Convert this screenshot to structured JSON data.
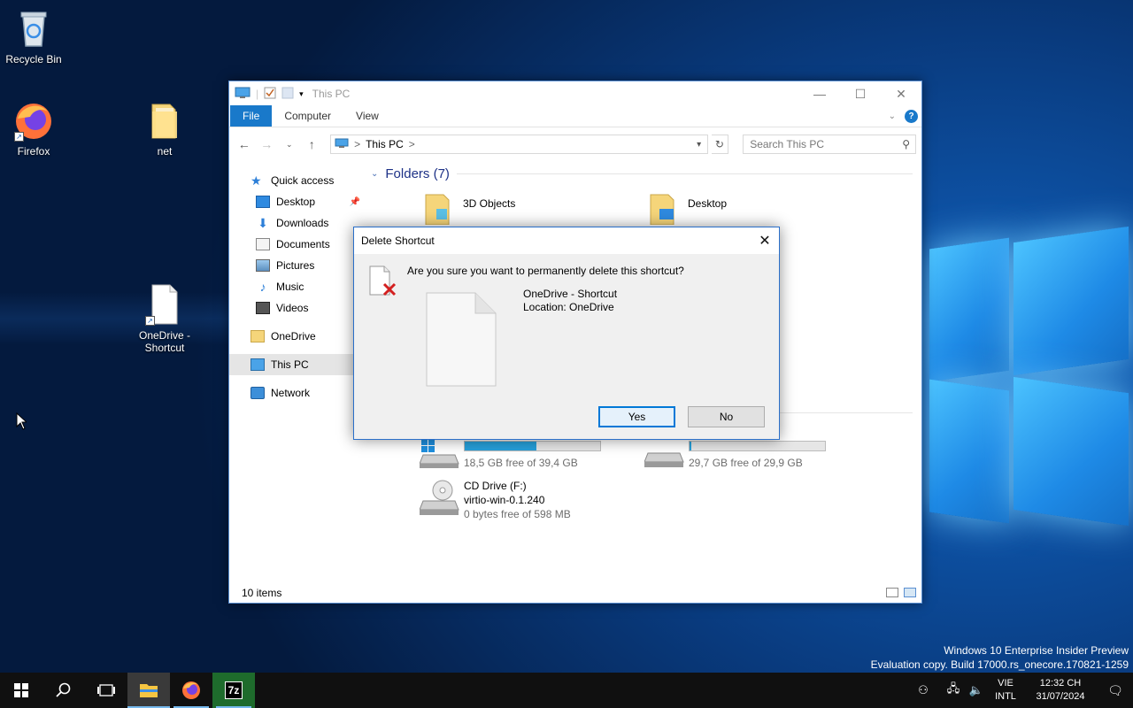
{
  "desktop": {
    "icons": [
      {
        "label": "Recycle Bin",
        "icon": "recycle-bin-icon"
      },
      {
        "label": "Firefox",
        "icon": "firefox-icon"
      },
      {
        "label": "net",
        "icon": "folder-icon"
      },
      {
        "label": "OneDrive - Shortcut",
        "line1": "OneDrive -",
        "line2": "Shortcut",
        "icon": "shortcut-file-icon"
      }
    ],
    "watermark": {
      "line1": "Windows 10 Enterprise Insider Preview",
      "line2": "Evaluation copy. Build 17000.rs_onecore.170821-1259"
    }
  },
  "explorer": {
    "title": "This PC",
    "ribbon_tabs": [
      "File",
      "Computer",
      "View"
    ],
    "address": {
      "crumb": "This PC",
      "sep": ">"
    },
    "search_placeholder": "Search This PC",
    "nav": [
      {
        "label": "Quick access",
        "icon": "star-icon"
      },
      {
        "label": "Desktop",
        "icon": "desktop-icon",
        "pinned": true
      },
      {
        "label": "Downloads",
        "icon": "download-icon"
      },
      {
        "label": "Documents",
        "icon": "documents-icon"
      },
      {
        "label": "Pictures",
        "icon": "pictures-icon"
      },
      {
        "label": "Music",
        "icon": "music-icon"
      },
      {
        "label": "Videos",
        "icon": "videos-icon"
      },
      {
        "label": "OneDrive",
        "icon": "folder-icon"
      },
      {
        "label": "This PC",
        "icon": "computer-icon",
        "selected": true
      },
      {
        "label": "Network",
        "icon": "network-icon"
      }
    ],
    "folders_header": "Folders (7)",
    "folders": [
      "3D Objects",
      "Desktop"
    ],
    "drives": [
      {
        "free": "18,5 GB free of 39,4 GB",
        "used_fraction": 0.53
      },
      {
        "free": "29,7 GB free of 29,9 GB",
        "used_fraction": 0.01
      },
      {
        "name": "CD Drive (F:)",
        "label": "virtio-win-0.1.240",
        "free": "0 bytes free of 598 MB"
      }
    ],
    "status": "10 items"
  },
  "dialog": {
    "title": "Delete Shortcut",
    "question": "Are you sure you want to permanently delete this shortcut?",
    "item_name": "OneDrive - Shortcut",
    "item_location": "Location: OneDrive",
    "yes_label": "Yes",
    "no_label": "No"
  },
  "taskbar": {
    "lang_line1": "VIE",
    "lang_line2": "INTL",
    "time": "12:32 CH",
    "date": "31/07/2024",
    "apps": [
      "start-icon",
      "search-icon",
      "task-view-icon",
      "file-explorer-icon",
      "firefox-icon",
      "7zip-icon"
    ]
  },
  "colors": {
    "accent": "#1979ca",
    "drive_fill": "#26a0da",
    "dialog_border": "#2a6fc9"
  }
}
